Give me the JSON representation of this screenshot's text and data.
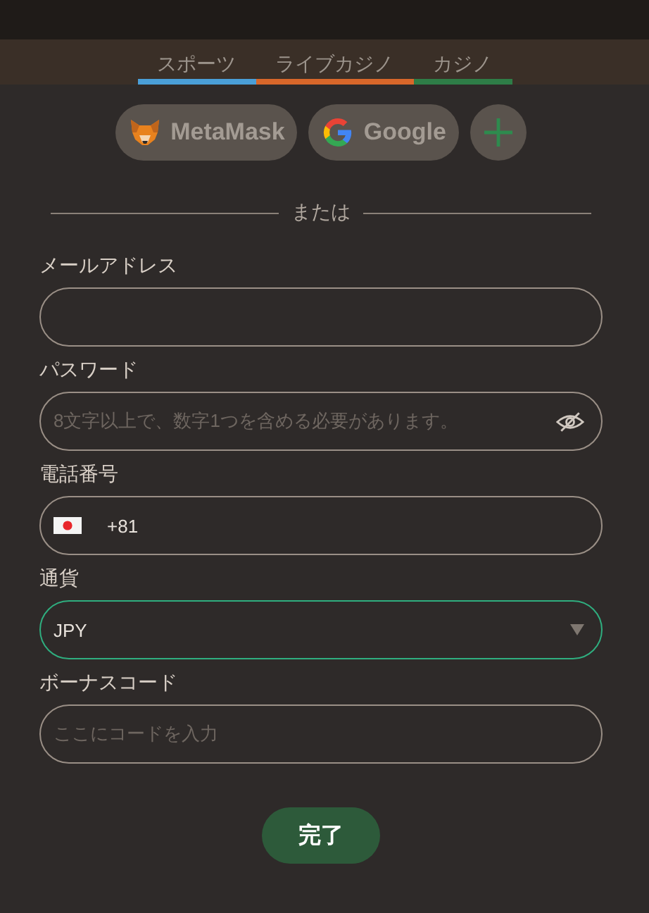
{
  "tabs": [
    {
      "label": "スポーツ",
      "color": "#4a9fd8"
    },
    {
      "label": "ライブカジノ",
      "color": "#d8672a"
    },
    {
      "label": "カジノ",
      "color": "#2e7d47"
    }
  ],
  "social_buttons": [
    {
      "kind": "metamask",
      "label": "MetaMask"
    },
    {
      "kind": "google",
      "label": "Google"
    },
    {
      "kind": "more"
    }
  ],
  "divider_text": "または",
  "fields": [
    {
      "kind": "text",
      "label": "メールアドレス",
      "focused": false
    },
    {
      "kind": "password",
      "label": "パスワード",
      "placeholder": "8文字以上で、数字1つを含める必要があります。",
      "focused": false
    },
    {
      "kind": "phone",
      "label": "電話番号",
      "value": "+81",
      "focused": false
    },
    {
      "kind": "select",
      "label": "通貨",
      "value": "JPY",
      "focused": true
    },
    {
      "kind": "text",
      "label": "ボーナスコード",
      "placeholder": "ここにコードを入力",
      "focused": false
    }
  ],
  "submit_button": "完了"
}
